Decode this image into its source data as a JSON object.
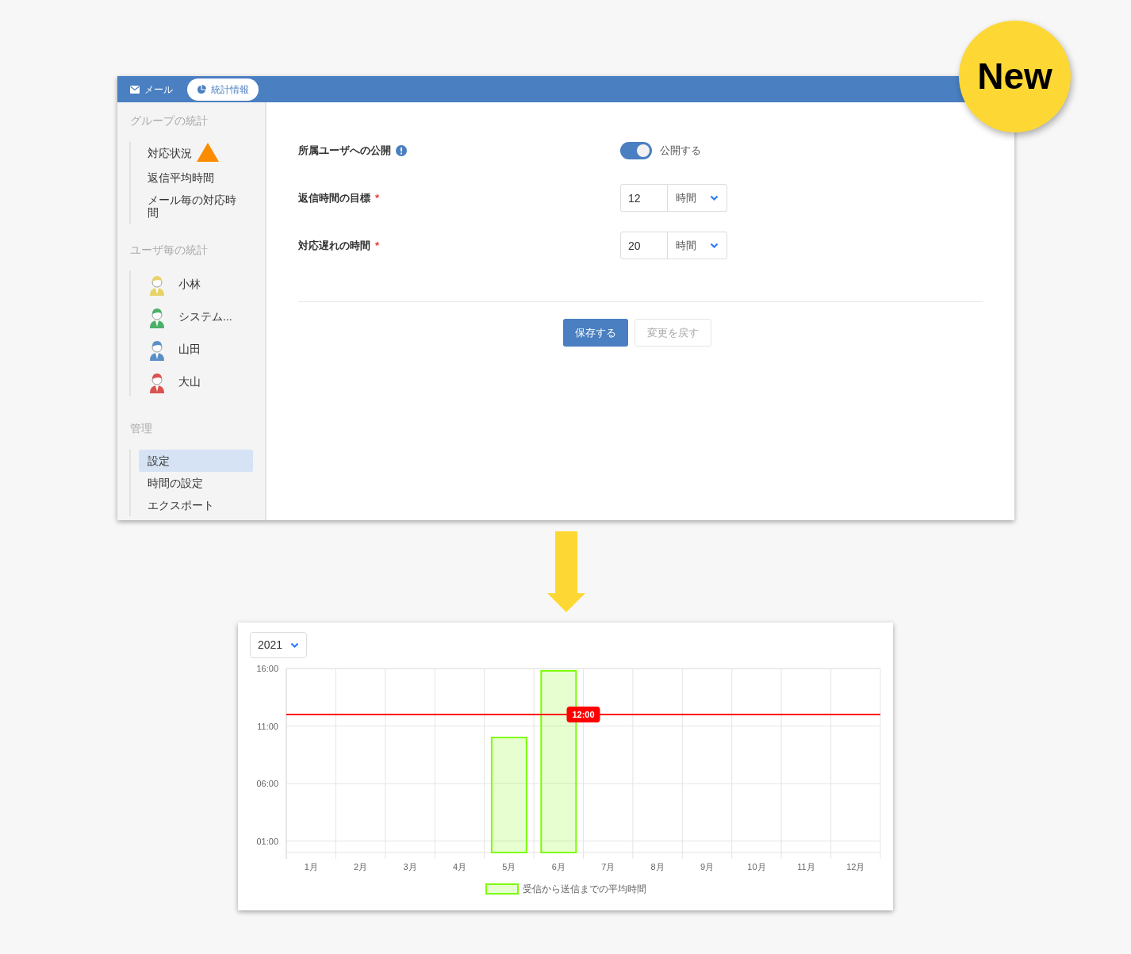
{
  "badge": {
    "text": "New"
  },
  "nav_tabs": [
    {
      "label": "メール",
      "selected": false
    },
    {
      "label": "統計情報",
      "selected": true
    }
  ],
  "sidebar": {
    "groups": [
      {
        "title": "グループの統計",
        "kind": "plain",
        "items": [
          {
            "label": "対応状況",
            "warning": true,
            "selected": false
          },
          {
            "label": "返信平均時間",
            "warning": false,
            "selected": false
          },
          {
            "label": "メール毎の対応時間",
            "warning": false,
            "selected": false
          }
        ]
      },
      {
        "title": "ユーザ毎の統計",
        "kind": "users",
        "items": [
          {
            "label": "小林",
            "color": "#e8d36a",
            "selected": false
          },
          {
            "label": "システム...",
            "color": "#4caf6a",
            "selected": false
          },
          {
            "label": "山田",
            "color": "#5b8fc7",
            "selected": false
          },
          {
            "label": "大山",
            "color": "#d9534f",
            "selected": false
          }
        ]
      },
      {
        "title": "管理",
        "kind": "plain",
        "items": [
          {
            "label": "設定",
            "warning": false,
            "selected": true
          },
          {
            "label": "時間の設定",
            "warning": false,
            "selected": false
          },
          {
            "label": "エクスポート",
            "warning": false,
            "selected": false
          }
        ]
      }
    ]
  },
  "form": {
    "rows": [
      {
        "kind": "toggle",
        "label": "所属ユーザへの公開",
        "info": true,
        "on": true,
        "toggle_label": "公開する"
      },
      {
        "kind": "duration",
        "label": "返信時間の目標",
        "required_mark": "*",
        "value": "12",
        "unit": "時間"
      },
      {
        "kind": "duration",
        "label": "対応遅れの時間",
        "required_mark": "*",
        "value": "20",
        "unit": "時間"
      }
    ],
    "buttons": [
      {
        "label": "保存する",
        "disabled": false
      },
      {
        "label": "変更を戻す",
        "disabled": true
      }
    ]
  },
  "chart_panel": {
    "year": "2021",
    "chart_data": {
      "type": "bar",
      "categories": [
        "1月",
        "2月",
        "3月",
        "4月",
        "5月",
        "6月",
        "7月",
        "8月",
        "9月",
        "10月",
        "11月",
        "12月"
      ],
      "series": [
        {
          "name": "受信から送信までの平均時間",
          "color": "#7cfc00",
          "values": [
            null,
            null,
            null,
            null,
            10,
            15.8,
            null,
            null,
            null,
            null,
            null,
            null
          ]
        }
      ],
      "ylim": [
        0,
        16
      ],
      "yticks": [
        {
          "value": 1,
          "label": "01:00"
        },
        {
          "value": 6,
          "label": "06:00"
        },
        {
          "value": 11,
          "label": "11:00"
        },
        {
          "value": 16,
          "label": "16:00"
        }
      ],
      "grid": true,
      "ref_lines": [
        {
          "axis": "y",
          "value": 12,
          "label": "12:00",
          "color": "#ff0000"
        }
      ]
    }
  }
}
